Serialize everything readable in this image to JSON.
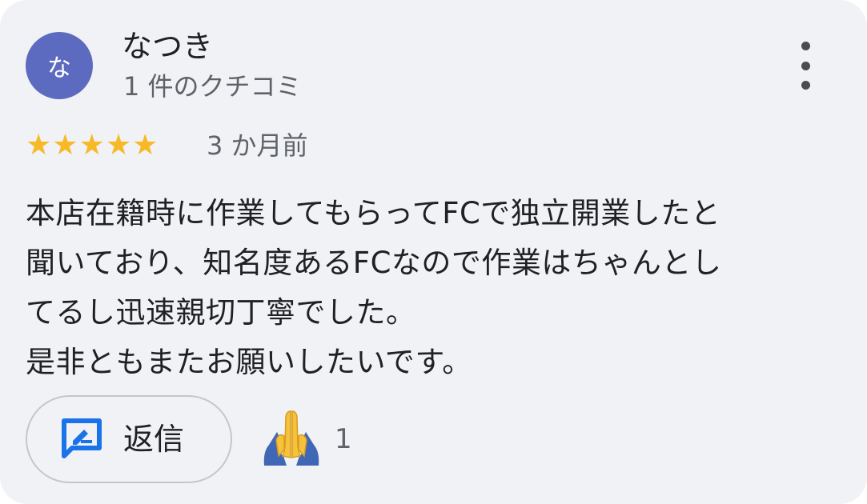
{
  "review": {
    "avatar_initial": "な",
    "author_name": "なつき",
    "review_count": "1 件のクチコミ",
    "rating": 5,
    "rating_max": 5,
    "time_ago": "3 か月前",
    "text": "本店在籍時に作業してもらってFCで独立開業したと\n聞いており、知名度あるFCなので作業はちゃんとし\nてるし迅速親切丁寧でした。\n是非ともまたお願いしたいです。"
  },
  "actions": {
    "reply_label": "返信",
    "reaction_count": "1"
  },
  "icons": {
    "more": "more-vert-icon",
    "star": "star-icon",
    "reply": "reply-icon",
    "reaction": "folded-hands-emoji-icon"
  },
  "colors": {
    "card_background": "#f1f2f5",
    "avatar": "#5c6bc0",
    "star": "#f7b928",
    "reply_icon": "#1a73e8",
    "text_primary": "#202124",
    "text_secondary": "#5f6368"
  }
}
